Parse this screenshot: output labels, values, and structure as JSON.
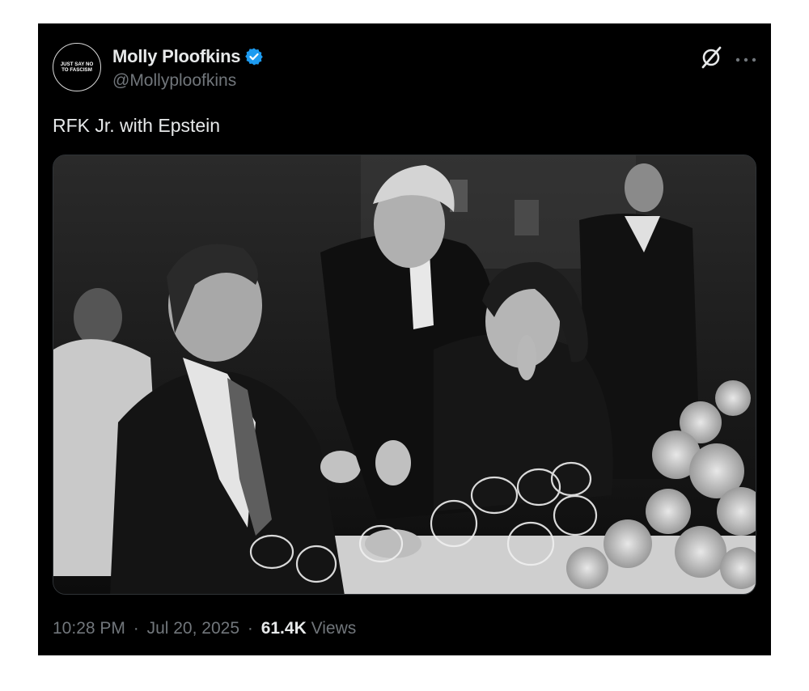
{
  "author": {
    "display_name": "Molly Ploofkins",
    "handle": "@Mollyploofkins",
    "avatar_text_line1": "JUST SAY NO",
    "avatar_text_line2": "TO FASCISM",
    "verified": true,
    "verified_color": "#1d9bf0"
  },
  "header_icons": [
    "grok-icon",
    "more-icon"
  ],
  "tweet": {
    "text": "RFK Jr. with Epstein",
    "photo": {
      "description_type": "black-and-white photograph"
    }
  },
  "meta": {
    "time": "10:28 PM",
    "separator": "·",
    "date": "Jul 20, 2025",
    "views_count": "61.4K",
    "views_label": "Views"
  },
  "colors": {
    "background": "#000000",
    "text_primary": "#e7e9ea",
    "text_secondary": "#71767b",
    "page_outer": "#ffffff"
  }
}
